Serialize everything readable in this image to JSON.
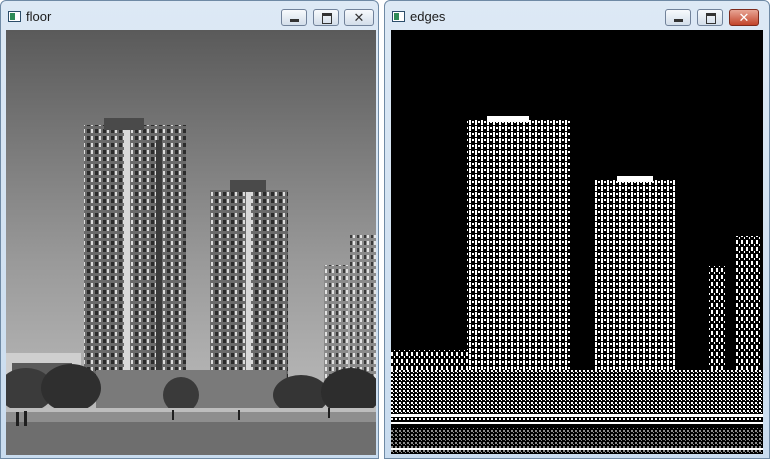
{
  "windows": [
    {
      "title": "floor",
      "buttons": {
        "minimize": "minimize",
        "maximize": "maximize",
        "close": "✕"
      }
    },
    {
      "title": "edges",
      "buttons": {
        "minimize": "minimize",
        "maximize": "maximize",
        "close": "✕"
      }
    }
  ],
  "colors": {
    "title_bar": "#c9dcef",
    "close_active": "#c2442a",
    "edges_background": "#000000",
    "edges_foreground": "#ffffff"
  }
}
